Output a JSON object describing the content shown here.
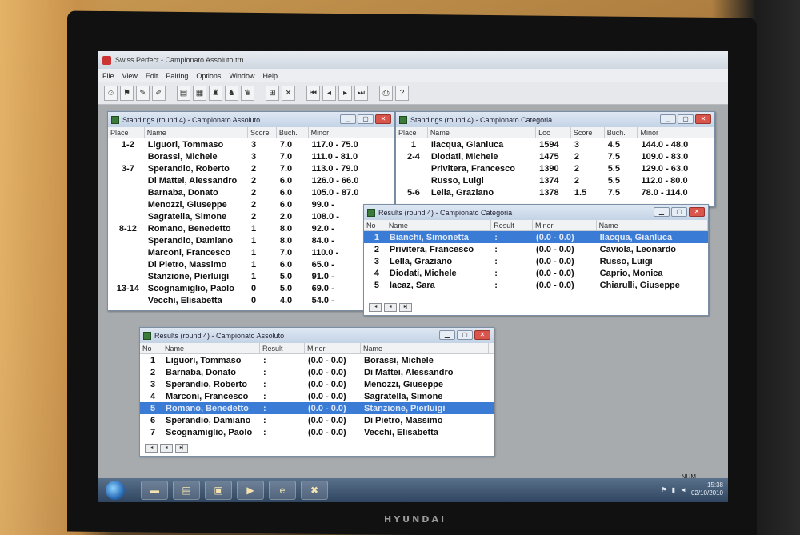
{
  "app": {
    "title": "Swiss Perfect - Campionato Assoluto.trn",
    "menu": [
      "File",
      "View",
      "Edit",
      "Pairing",
      "Options",
      "Window",
      "Help"
    ]
  },
  "toolbar": {
    "buttons": [
      {
        "name": "players-icon",
        "glyph": "☺"
      },
      {
        "name": "teams-icon",
        "glyph": "⚑"
      },
      {
        "name": "pair-icon",
        "glyph": "✎"
      },
      {
        "name": "pair-edit-icon",
        "glyph": "✐"
      },
      {
        "name": "standings-icon",
        "glyph": "▤"
      },
      {
        "name": "crosstable-icon",
        "glyph": "▦"
      },
      {
        "name": "ratings-icon",
        "glyph": "♜"
      },
      {
        "name": "results-icon",
        "glyph": "♞"
      },
      {
        "name": "table-icon",
        "glyph": "♛"
      },
      {
        "name": "export-icon",
        "glyph": "⊞"
      },
      {
        "name": "close-tournament-icon",
        "glyph": "✕"
      },
      {
        "name": "first-round-icon",
        "glyph": "⏮"
      },
      {
        "name": "prev-round-icon",
        "glyph": "◂"
      },
      {
        "name": "next-round-icon",
        "glyph": "▸"
      },
      {
        "name": "last-round-icon",
        "glyph": "⏭"
      },
      {
        "name": "print-icon",
        "glyph": "⎙"
      },
      {
        "name": "help-icon",
        "glyph": "?"
      }
    ]
  },
  "standings_assoluto": {
    "title": "Standings  (round 4) - Campionato Assoluto",
    "columns": [
      "Place",
      "Name",
      "Score",
      "Buch.",
      "Minor"
    ],
    "rows": [
      {
        "place": "1-2",
        "name": "Liguori, Tommaso",
        "score": "3",
        "buch": "7.0",
        "minor": "117.0  -  75.0"
      },
      {
        "place": "",
        "name": "Borassi, Michele",
        "score": "3",
        "buch": "7.0",
        "minor": "111.0  -  81.0"
      },
      {
        "place": "3-7",
        "name": "Sperandio, Roberto",
        "score": "2",
        "buch": "7.0",
        "minor": "113.0  -  79.0"
      },
      {
        "place": "",
        "name": "Di Mattei, Alessandro",
        "score": "2",
        "buch": "6.0",
        "minor": "126.0  -  66.0"
      },
      {
        "place": "",
        "name": "Barnaba, Donato",
        "score": "2",
        "buch": "6.0",
        "minor": "105.0  -  87.0"
      },
      {
        "place": "",
        "name": "Menozzi, Giuseppe",
        "score": "2",
        "buch": "6.0",
        "minor": "99.0  -"
      },
      {
        "place": "",
        "name": "Sagratella, Simone",
        "score": "2",
        "buch": "2.0",
        "minor": "108.0  -"
      },
      {
        "place": "8-12",
        "name": "Romano, Benedetto",
        "score": "1",
        "buch": "8.0",
        "minor": "92.0  -"
      },
      {
        "place": "",
        "name": "Sperandio, Damiano",
        "score": "1",
        "buch": "8.0",
        "minor": "84.0  -"
      },
      {
        "place": "",
        "name": "Marconi, Francesco",
        "score": "1",
        "buch": "7.0",
        "minor": "110.0  -"
      },
      {
        "place": "",
        "name": "Di Pietro, Massimo",
        "score": "1",
        "buch": "6.0",
        "minor": "65.0  -"
      },
      {
        "place": "",
        "name": "Stanzione, Pierluigi",
        "score": "1",
        "buch": "5.0",
        "minor": "91.0  -"
      },
      {
        "place": "13-14",
        "name": "Scognamiglio, Paolo",
        "score": "0",
        "buch": "5.0",
        "minor": "69.0  -"
      },
      {
        "place": "",
        "name": "Vecchi, Elisabetta",
        "score": "0",
        "buch": "4.0",
        "minor": "54.0  -"
      }
    ]
  },
  "standings_categoria": {
    "title": "Standings  (round 4) - Campionato Categoria",
    "columns": [
      "Place",
      "Name",
      "Loc",
      "Score",
      "Buch.",
      "Minor"
    ],
    "rows": [
      {
        "place": "1",
        "name": "Ilacqua, Gianluca",
        "loc": "1594",
        "score": "3",
        "buch": "4.5",
        "minor": "144.0  -  48.0"
      },
      {
        "place": "2-4",
        "name": "Diodati, Michele",
        "loc": "1475",
        "score": "2",
        "buch": "7.5",
        "minor": "109.0  -  83.0"
      },
      {
        "place": "",
        "name": "Privitera, Francesco",
        "loc": "1390",
        "score": "2",
        "buch": "5.5",
        "minor": "129.0  -  63.0"
      },
      {
        "place": "",
        "name": "Russo, Luigi",
        "loc": "1374",
        "score": "2",
        "buch": "5.5",
        "minor": "112.0  -  80.0"
      },
      {
        "place": "5-6",
        "name": "Lella, Graziano",
        "loc": "1378",
        "score": "1.5",
        "buch": "7.5",
        "minor": "78.0  -  114.0"
      }
    ]
  },
  "results_categoria": {
    "title": "Results  (round 4) - Campionato Categoria",
    "columns": [
      "No",
      "Name",
      "Result",
      "Minor",
      "Name"
    ],
    "rows": [
      {
        "no": "1",
        "white": "Bianchi, Simonetta",
        "result": ":",
        "minor": "(0.0  -  0.0)",
        "black": "Ilacqua, Gianluca"
      },
      {
        "no": "2",
        "white": "Privitera, Francesco",
        "result": ":",
        "minor": "(0.0  -  0.0)",
        "black": "Caviola, Leonardo"
      },
      {
        "no": "3",
        "white": "Lella, Graziano",
        "result": ":",
        "minor": "(0.0  -  0.0)",
        "black": "Russo, Luigi"
      },
      {
        "no": "4",
        "white": "Diodati, Michele",
        "result": ":",
        "minor": "(0.0  -  0.0)",
        "black": "Caprio, Monica"
      },
      {
        "no": "5",
        "white": "Iacaz, Sara",
        "result": ":",
        "minor": "(0.0  -  0.0)",
        "black": "Chiarulli, Giuseppe"
      }
    ],
    "selected": 0
  },
  "results_assoluto": {
    "title": "Results  (round 4) - Campionato Assoluto",
    "columns": [
      "No",
      "Name",
      "Result",
      "Minor",
      "Name"
    ],
    "rows": [
      {
        "no": "1",
        "white": "Liguori, Tommaso",
        "result": ":",
        "minor": "(0.0  -  0.0)",
        "black": "Borassi, Michele"
      },
      {
        "no": "2",
        "white": "Barnaba, Donato",
        "result": ":",
        "minor": "(0.0  -  0.0)",
        "black": "Di Mattei, Alessandro"
      },
      {
        "no": "3",
        "white": "Sperandio, Roberto",
        "result": ":",
        "minor": "(0.0  -  0.0)",
        "black": "Menozzi, Giuseppe"
      },
      {
        "no": "4",
        "white": "Marconi, Francesco",
        "result": ":",
        "minor": "(0.0  -  0.0)",
        "black": "Sagratella, Simone"
      },
      {
        "no": "5",
        "white": "Romano, Benedetto",
        "result": ":",
        "minor": "(0.0  -  0.0)",
        "black": "Stanzione, Pierluigi"
      },
      {
        "no": "6",
        "white": "Sperandio, Damiano",
        "result": ":",
        "minor": "(0.0  -  0.0)",
        "black": "Di Pietro, Massimo"
      },
      {
        "no": "7",
        "white": "Scognamiglio, Paolo",
        "result": ":",
        "minor": "(0.0  -  0.0)",
        "black": "Vecchi, Elisabetta"
      }
    ],
    "selected": 4
  },
  "status": {
    "num": "NUM",
    "time": "15:38",
    "date": "02/10/2010"
  },
  "monitor": {
    "brand": "HYUNDAI"
  },
  "colors": {
    "selection": "#3a7bd5",
    "title_gradient": "#c3d3e6",
    "taskbar": "#2f4560"
  }
}
